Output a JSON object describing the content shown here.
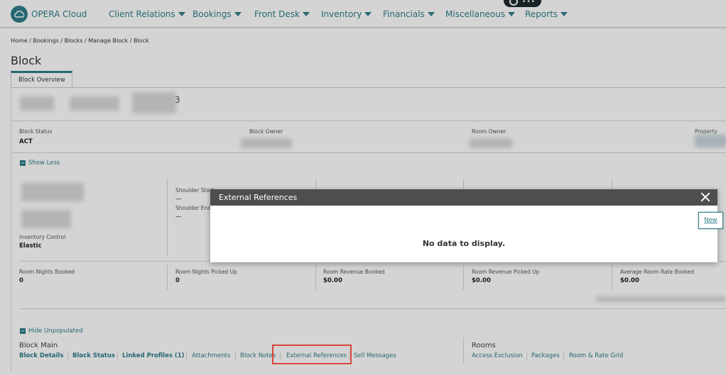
{
  "app": {
    "brand": "OPERA Cloud"
  },
  "nav": [
    {
      "label": "Client Relations"
    },
    {
      "label": "Bookings"
    },
    {
      "label": "Front Desk"
    },
    {
      "label": "Inventory"
    },
    {
      "label": "Financials"
    },
    {
      "label": "Miscellaneous"
    },
    {
      "label": "Reports"
    }
  ],
  "breadcrumb": "Home / Bookings / Blocks / Manage Block / Block",
  "page": {
    "title": "Block",
    "tab": "Block Overview",
    "header_fragment": "3"
  },
  "status_row": {
    "block_status_label": "Block Status",
    "block_status_value": "ACT",
    "block_owner_label": "Block Owner",
    "room_owner_label": "Room Owner",
    "property_label": "Property"
  },
  "show_less": "Show Less",
  "details": {
    "inventory_control_label": "Inventory Control",
    "inventory_control_value": "Elastic",
    "shoulder_start_label": "Shoulder Start",
    "shoulder_start_value": "—",
    "shoulder_end_label": "Shoulder End",
    "shoulder_end_value": "—"
  },
  "stats": [
    {
      "label": "Room Nights Booked",
      "value": "0"
    },
    {
      "label": "Room Nights Picked Up",
      "value": "0"
    },
    {
      "label": "Room Revenue Booked",
      "value": "$0.00"
    },
    {
      "label": "Room Revenue Picked Up",
      "value": "$0.00"
    },
    {
      "label": "Average Room Rate Booked",
      "value": "$0.00"
    }
  ],
  "hide_unpopulated": "Hide Unpopulated",
  "block_main": {
    "heading": "Block Main",
    "links": [
      "Block Details",
      "Block Status",
      "Linked Profiles (1)",
      "Attachments",
      "Block Notes",
      "External References",
      "Sell Messages"
    ]
  },
  "rooms": {
    "heading": "Rooms",
    "links": [
      "Access Exclusion",
      "Packages",
      "Room & Rate Grid"
    ]
  },
  "dialog": {
    "title": "External References",
    "empty_message": "No data to display.",
    "new_label": "New"
  }
}
